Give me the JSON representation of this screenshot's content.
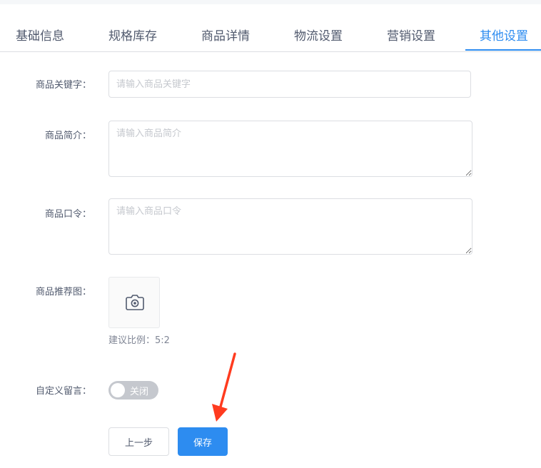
{
  "tabs": [
    {
      "label": "基础信息",
      "active": false
    },
    {
      "label": "规格库存",
      "active": false
    },
    {
      "label": "商品详情",
      "active": false
    },
    {
      "label": "物流设置",
      "active": false
    },
    {
      "label": "营销设置",
      "active": false
    },
    {
      "label": "其他设置",
      "active": true
    }
  ],
  "form": {
    "keyword": {
      "label": "商品关键字：",
      "placeholder": "请输入商品关键字",
      "value": ""
    },
    "intro": {
      "label": "商品简介：",
      "placeholder": "请输入商品简介",
      "value": ""
    },
    "password": {
      "label": "商品口令：",
      "placeholder": "请输入商品口令",
      "value": ""
    },
    "recommend_image": {
      "label": "商品推荐图：",
      "hint": "建议比例：5:2",
      "icon": "camera-icon"
    },
    "custom_message": {
      "label": "自定义留言：",
      "switch_text": "关闭",
      "enabled": false
    }
  },
  "actions": {
    "prev_label": "上一步",
    "save_label": "保存"
  },
  "colors": {
    "accent": "#2d8cf0",
    "annotation_arrow": "#ff3b1f",
    "switch_off": "#c5c8ce"
  }
}
